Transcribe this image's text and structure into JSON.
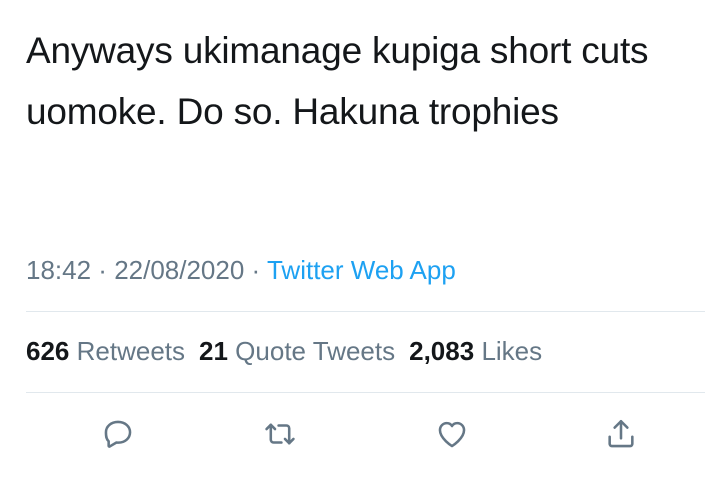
{
  "tweet": {
    "text": "Anyways ukimanage kupiga short cuts uomoke. Do so. Hakuna trophies",
    "time": "18:42",
    "date": "22/08/2020",
    "source": "Twitter Web App",
    "separator": " · "
  },
  "stats": {
    "retweets_count": "626",
    "retweets_label": "Retweets",
    "quotes_count": "21",
    "quotes_label": "Quote Tweets",
    "likes_count": "2,083",
    "likes_label": "Likes"
  },
  "actions": {
    "reply_icon": "reply-icon",
    "retweet_icon": "retweet-icon",
    "like_icon": "heart-icon",
    "share_icon": "share-icon"
  },
  "colors": {
    "text": "#14171a",
    "secondary": "#657786",
    "link": "#1da1f2",
    "divider": "#e1e8ed"
  }
}
